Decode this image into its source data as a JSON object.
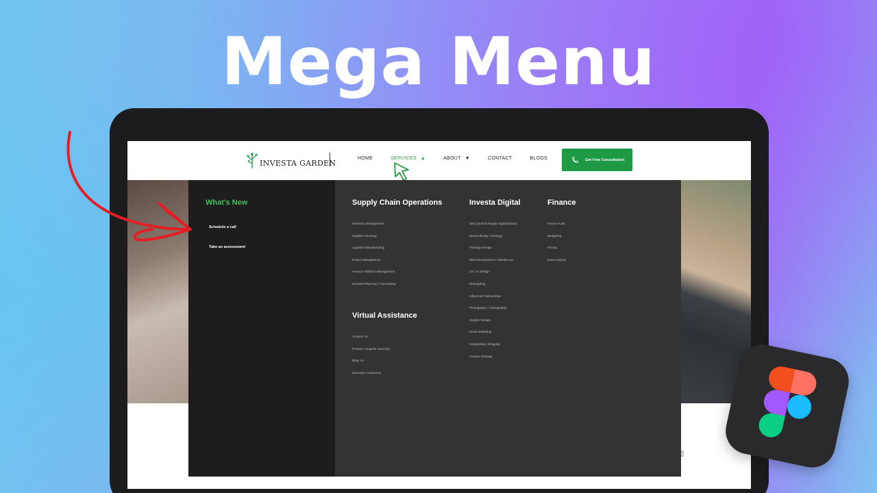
{
  "headline": "Mega Menu",
  "brand": {
    "logo_text": "INVESTA GARDEN",
    "accent": "#1e9a45",
    "highlight": "#3ec15a"
  },
  "nav": {
    "items": [
      {
        "label": "HOME"
      },
      {
        "label": "SERVICES",
        "caret": "▲"
      },
      {
        "label": "ABOUT",
        "caret": "▼"
      },
      {
        "label": "CONTACT"
      },
      {
        "label": "BLOGS"
      }
    ],
    "cta_label": "Get Free Consultation"
  },
  "mega_menu": {
    "whats_new": {
      "title": "What's New",
      "links": [
        "Schedule a call",
        "Take an assessment"
      ]
    },
    "columns": [
      {
        "title": "Supply Chain Operations",
        "items": [
          "Inventory Management",
          "Supplier Sourcing",
          "Logistics  Manufacturing",
          "Project Management",
          "Amazon Platform Management",
          "Demand Planning / Forecasting"
        ]
      },
      {
        "title": "Virtual Assistance",
        "items": [
          "Amazon VA",
          "Product / Supplier Sourcing",
          "Ebay VA",
          "Executive Assistance"
        ]
      },
      {
        "title": "Investa Digital",
        "items": [
          "SEO (Search Engine Optimization)",
          "Brand Identity / Strategy",
          "Package Design",
          "Web Development / Website QA",
          "UX / UI Design",
          "Retargeting",
          "Influencer Partnerships",
          "Photography / Videography",
          "Graphic Design",
          "Email Marketing",
          "Copywriting / Blogging",
          "Content Strategy"
        ]
      },
      {
        "title": "Finance",
        "items": [
          "Invoice Audit",
          "Budgeting",
          "Pricing",
          "Data Analysis"
        ]
      }
    ]
  },
  "icons": [
    "tree-logo-icon",
    "phone-icon",
    "cursor-icon",
    "figma-logo-icon",
    "red-arrow"
  ]
}
